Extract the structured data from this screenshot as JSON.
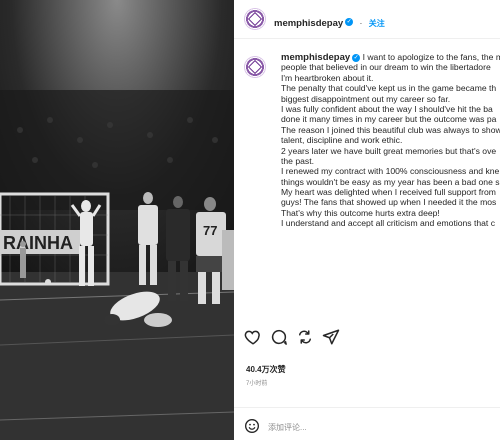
{
  "post": {
    "username": "memphisdepay",
    "verified_symbol": "✓",
    "follow_label": "关注",
    "header_separator": "·"
  },
  "caption": {
    "lines": [
      "I want to apologize to the fans, the m",
      "people that believed in our dream to win the libertadore",
      "I'm heartbroken about it.",
      "The penalty that could've kept us in the game became th",
      "biggest disappointment out my career so far.",
      "I was fully confident about the way I should've hit the ba",
      "done it many times in my career but the outcome was pa",
      "The reason I joined this beautiful club was always to show",
      "talent, discipline and work ethic.",
      "2 years later we have built great memories but that's ove",
      "the past.",
      "I renewed my contract with 100% consciousness and kne",
      "things wouldn't be easy as my year has been a bad one s",
      "My heart was delighted when I received full support from",
      "guys! The fans that showed up when I needed it the mos",
      "That's why this outcome hurts extra deep!",
      "I understand and accept all criticism and emotions that c"
    ]
  },
  "engagement": {
    "likes": "40.4万次赞",
    "time": "7小时前"
  },
  "comment_box": {
    "placeholder": "添加评论..."
  },
  "icons": [
    "heart-icon",
    "comment-icon",
    "share-icon",
    "send-icon",
    "emoji-icon"
  ],
  "photo": {
    "banner_text": "RAINHA",
    "jersey_number": "77"
  }
}
